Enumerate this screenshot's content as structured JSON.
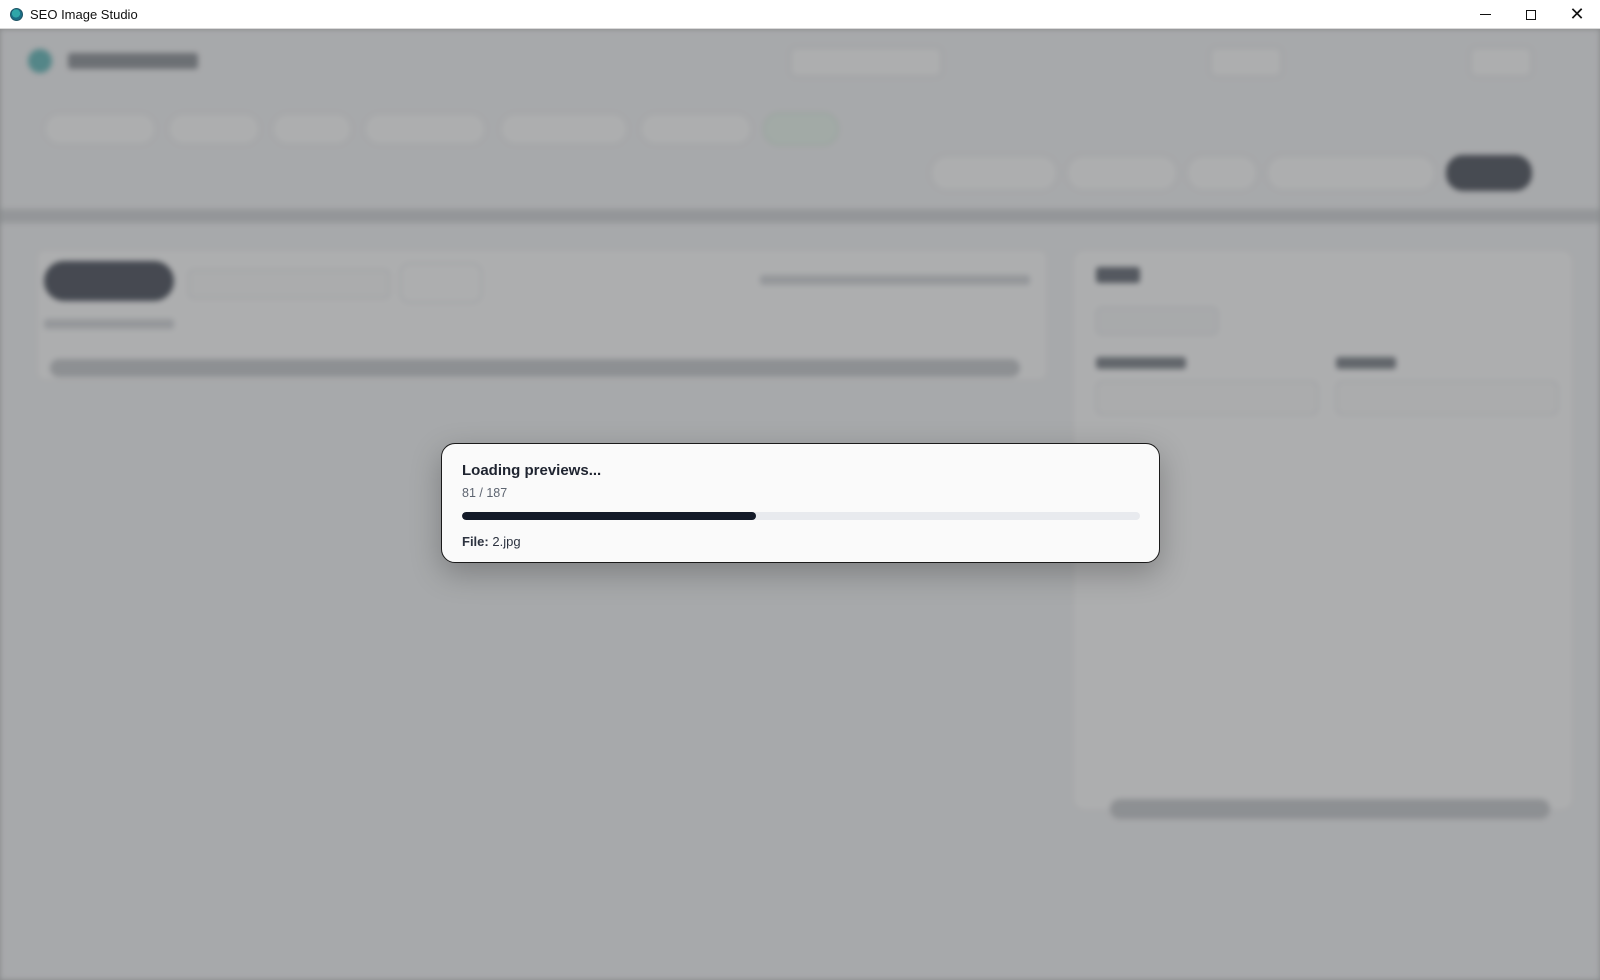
{
  "window": {
    "title": "SEO Image Studio",
    "icon": "app-logo-icon",
    "controls": {
      "minimize": "minimize-icon",
      "maximize": "maximize-icon",
      "close": "close-icon"
    }
  },
  "loading_modal": {
    "title": "Loading previews...",
    "count": "81 / 187",
    "progress_current": 81,
    "progress_total": 187,
    "file_label": "File:",
    "file_name": "2.jpg"
  },
  "colors": {
    "progress_fill": "#131a28",
    "progress_track": "#e8eaee",
    "modal_bg": "#fafafa",
    "overlay": "#a9aaac"
  }
}
